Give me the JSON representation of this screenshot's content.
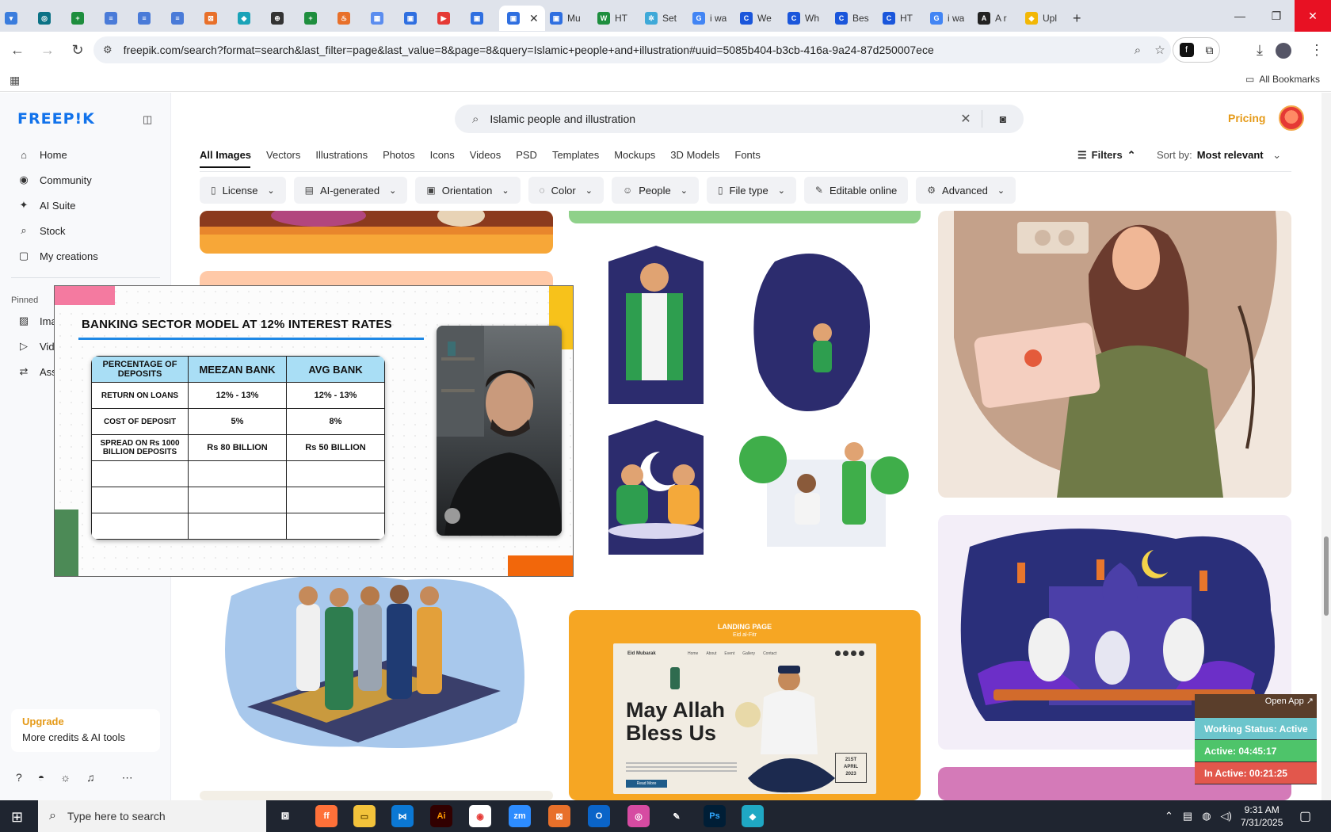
{
  "browser": {
    "tabs": [
      {
        "label": "",
        "color": "#3b7ddd",
        "glyph": "▾"
      },
      {
        "label": "",
        "color": "#0b7285",
        "glyph": "◎"
      },
      {
        "label": "",
        "color": "#1e8e3e",
        "glyph": "+"
      },
      {
        "label": "",
        "color": "#4a7bd8",
        "glyph": "≡"
      },
      {
        "label": "",
        "color": "#4a7bd8",
        "glyph": "≡"
      },
      {
        "label": "",
        "color": "#4a7bd8",
        "glyph": "≡"
      },
      {
        "label": "",
        "color": "#e8702a",
        "glyph": "⊠"
      },
      {
        "label": "",
        "color": "#1aa3b8",
        "glyph": "◆"
      },
      {
        "label": "",
        "color": "#333333",
        "glyph": "⊕"
      },
      {
        "label": "",
        "color": "#1e8e3e",
        "glyph": "+"
      },
      {
        "label": "",
        "color": "#e8702a",
        "glyph": "♨"
      },
      {
        "label": "",
        "color": "#5b8def",
        "glyph": "▦"
      },
      {
        "label": "",
        "color": "#2f6fe0",
        "glyph": "▣"
      },
      {
        "label": "",
        "color": "#e53935",
        "glyph": "▶"
      },
      {
        "label": "",
        "color": "#2f6fe0",
        "glyph": "▣"
      },
      {
        "label": "",
        "color": "#2f6fe0",
        "glyph": "▣",
        "active": true
      },
      {
        "label": "Mu",
        "color": "#2f6fe0",
        "glyph": "▣"
      },
      {
        "label": "HT",
        "color": "#1e8e3e",
        "glyph": "W"
      },
      {
        "label": "Set",
        "color": "#3fa9d8",
        "glyph": "✲"
      },
      {
        "label": "i wa",
        "color": "#4285f4",
        "glyph": "G"
      },
      {
        "label": "We",
        "color": "#1a56db",
        "glyph": "C"
      },
      {
        "label": "Wh",
        "color": "#1a56db",
        "glyph": "C"
      },
      {
        "label": "Bes",
        "color": "#1a56db",
        "glyph": "C"
      },
      {
        "label": "HT",
        "color": "#1a56db",
        "glyph": "C"
      },
      {
        "label": "i wa",
        "color": "#4285f4",
        "glyph": "G"
      },
      {
        "label": "A r",
        "color": "#222222",
        "glyph": "A"
      },
      {
        "label": "Upl",
        "color": "#f2b705",
        "glyph": "◆"
      }
    ],
    "new_tab": "+",
    "url": "freepik.com/search?format=search&last_filter=page&last_value=8&page=8&query=Islamic+people+and+illustration#uuid=5085b404-b3cb-416a-9a24-87d250007ece",
    "all_bookmarks": "All Bookmarks"
  },
  "freepik": {
    "logo": "FREEP!K",
    "nav": [
      {
        "label": "Home",
        "icon": "⌂"
      },
      {
        "label": "Community",
        "icon": "◉"
      },
      {
        "label": "AI Suite",
        "icon": "✦"
      },
      {
        "label": "Stock",
        "icon": "⌕"
      },
      {
        "label": "My creations",
        "icon": "▢"
      }
    ],
    "pinned_title": "Pinned",
    "pinned": [
      {
        "label": "Ima",
        "icon": "▨"
      },
      {
        "label": "Vide",
        "icon": "▷"
      },
      {
        "label": "Ass",
        "icon": "⇄"
      }
    ],
    "upgrade_title": "Upgrade",
    "upgrade_sub": "More credits & AI tools",
    "search_query": "Islamic people and illustration",
    "pricing": "Pricing",
    "categories": [
      "All Images",
      "Vectors",
      "Illustrations",
      "Photos",
      "Icons",
      "Videos",
      "PSD",
      "Templates",
      "Mockups",
      "3D Models",
      "Fonts"
    ],
    "filters_label": "Filters",
    "sort_label": "Sort by:",
    "sort_value": "Most relevant",
    "chips": [
      {
        "label": "License",
        "icon": "▯"
      },
      {
        "label": "AI-generated",
        "icon": "▤"
      },
      {
        "label": "Orientation",
        "icon": "▣"
      },
      {
        "label": "Color",
        "icon": "◌"
      },
      {
        "label": "People",
        "icon": "☺"
      },
      {
        "label": "File type",
        "icon": "▯"
      },
      {
        "label": "Editable online",
        "icon": "✎",
        "no_arrow": true
      },
      {
        "label": "Advanced",
        "icon": "⚙"
      }
    ],
    "landing": {
      "tag": "LANDING PAGE",
      "sub": "Eid al-Fitr",
      "headline1": "May Allah",
      "headline2": "Bless Us",
      "date1": "21ST",
      "date2": "APRIL",
      "date3": "2023",
      "cta": "Read More",
      "brand": "Eid Mubarak",
      "menu": [
        "Home",
        "About",
        "Event",
        "Gallery",
        "Contact"
      ]
    }
  },
  "overlay": {
    "title": "BANKING SECTOR MODEL AT 12% INTEREST RATES",
    "headers": [
      "PERCENTAGE OF DEPOSITS",
      "MEEZAN BANK",
      "AVG BANK"
    ],
    "rows": [
      [
        "RETURN ON LOANS",
        "12% - 13%",
        "12% - 13%"
      ],
      [
        "COST OF DEPOSIT",
        "5%",
        "8%"
      ],
      [
        "SPREAD ON Rs 1000 BILLION DEPOSITS",
        "Rs 80 BILLION",
        "Rs 50 BILLION"
      ],
      [
        "",
        "",
        ""
      ],
      [
        "",
        "",
        ""
      ],
      [
        "",
        "",
        ""
      ]
    ]
  },
  "status_widget": {
    "open_app": "Open App ↗",
    "working": "Working Status: Active",
    "active": "Active: 04:45:17",
    "inactive": "In Active: 00:21:25"
  },
  "taskbar": {
    "search_placeholder": "Type here to search",
    "time": "9:31 AM",
    "date": "7/31/2025"
  }
}
